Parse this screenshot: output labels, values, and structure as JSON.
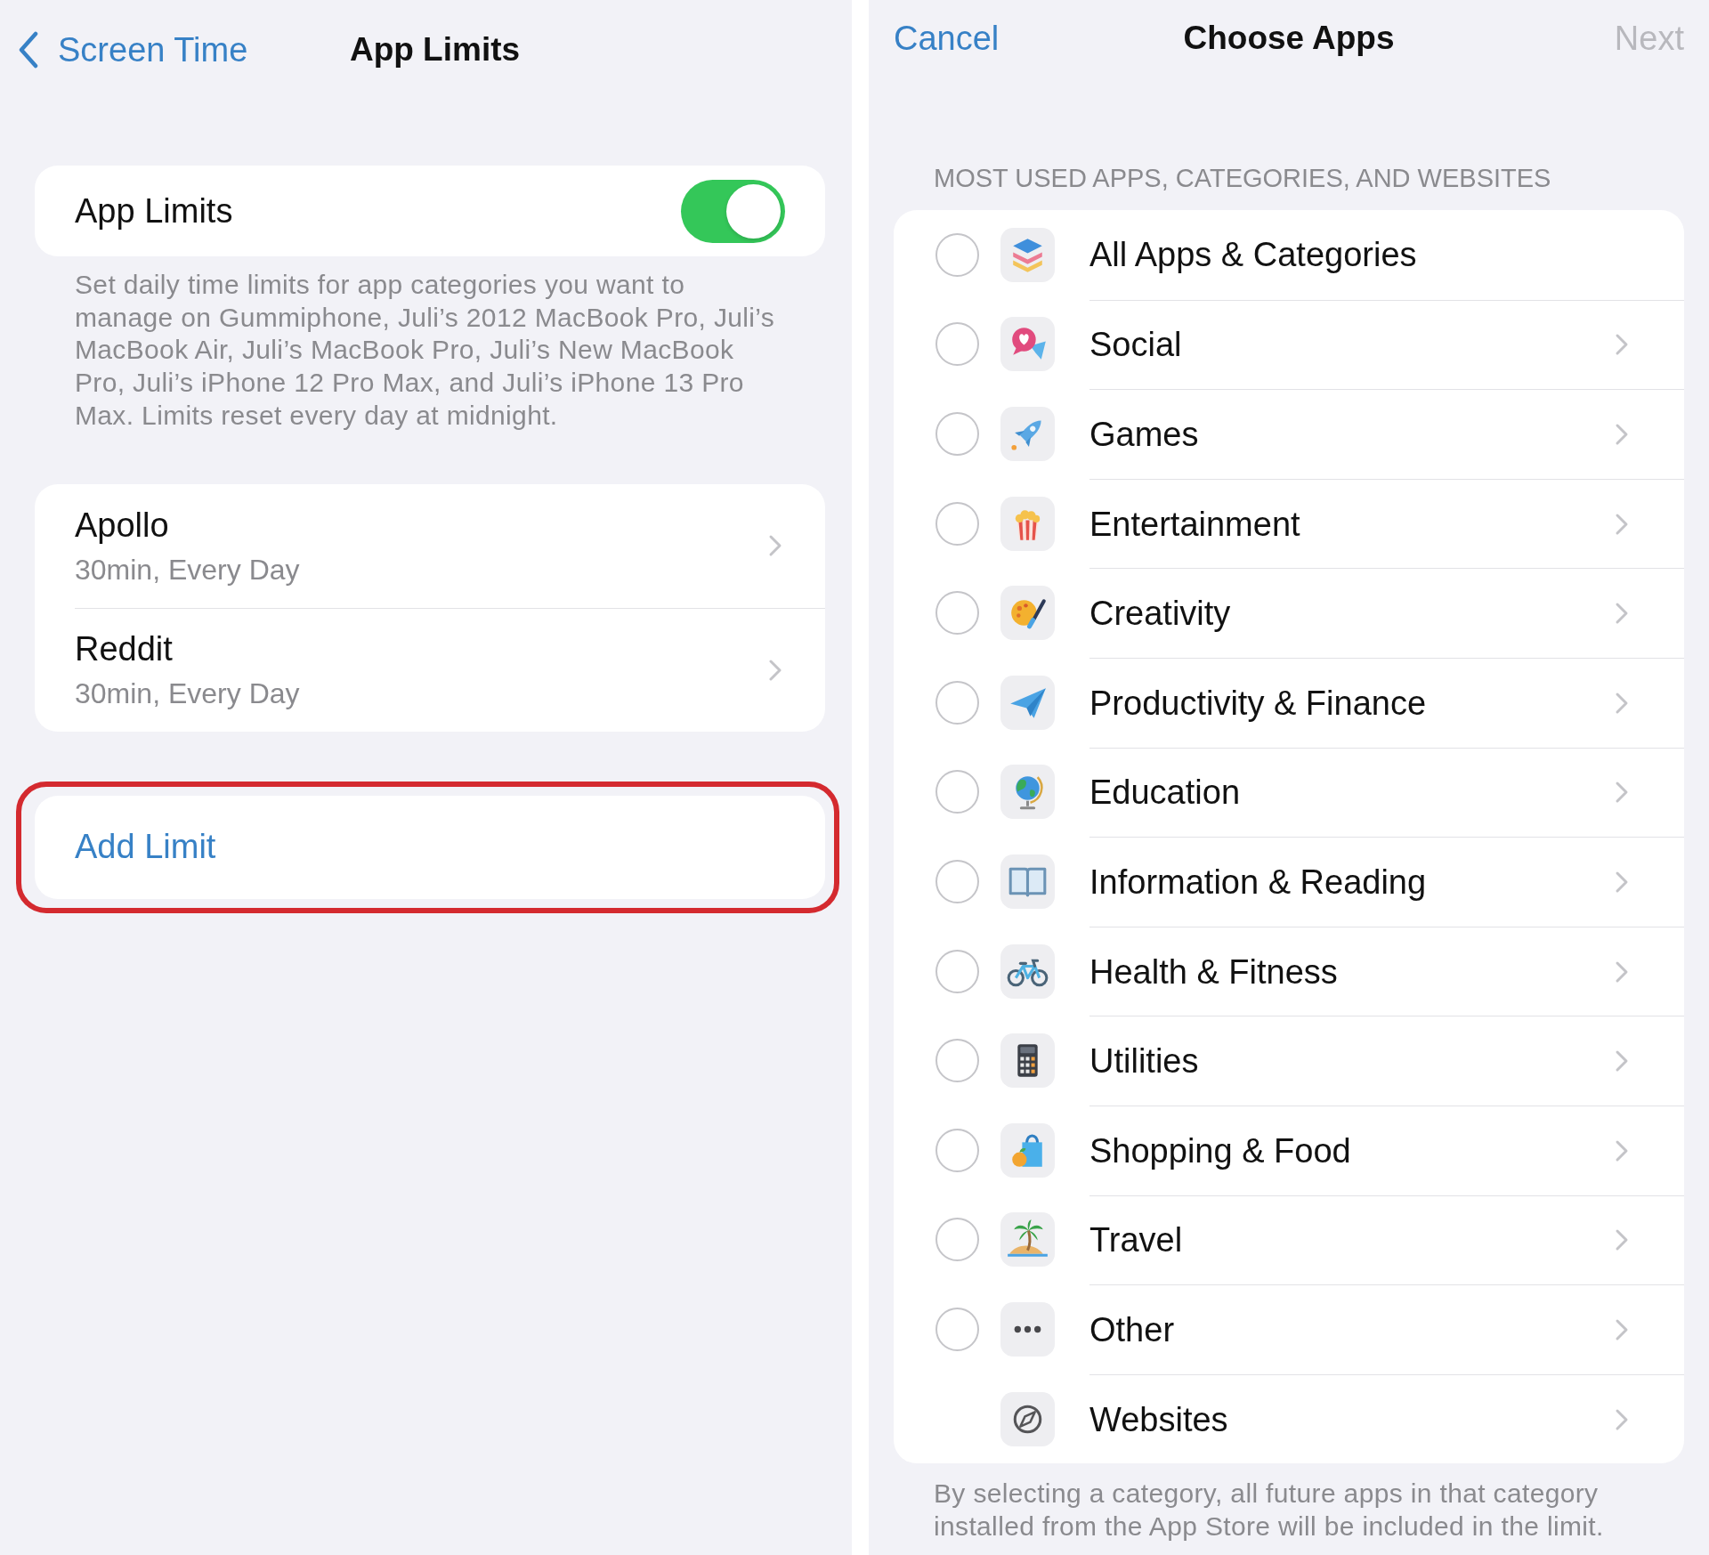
{
  "app_limits_screen": {
    "nav": {
      "back": "Screen Time",
      "title": "App Limits"
    },
    "toggle_row": {
      "label": "App Limits",
      "on": true
    },
    "footer": "Set daily time limits for app categories you want to manage on Gummiphone, Juli’s 2012 MacBook Pro, Juli’s MacBook Air, Juli’s MacBook Pro, Juli’s New MacBook Pro, Juli’s iPhone 12 Pro Max, and Juli’s iPhone 13 Pro Max. Limits reset every day at midnight.",
    "limits": [
      {
        "app": "Apollo",
        "schedule": "30min, Every Day"
      },
      {
        "app": "Reddit",
        "schedule": "30min, Every Day"
      }
    ],
    "add_limit": {
      "label": "Add Limit",
      "highlighted": true
    }
  },
  "choose_apps_screen": {
    "nav": {
      "cancel": "Cancel",
      "title": "Choose Apps",
      "next": {
        "label": "Next",
        "disabled": true
      }
    },
    "section_header": "MOST USED APPS, CATEGORIES, AND WEBSITES",
    "rows": [
      {
        "kind": "all",
        "label": "All Apps & Categories",
        "selected": false
      },
      {
        "kind": "category",
        "label": "Social",
        "selected": false
      },
      {
        "kind": "category",
        "label": "Games",
        "selected": false
      },
      {
        "kind": "category",
        "label": "Entertainment",
        "selected": false
      },
      {
        "kind": "category",
        "label": "Creativity",
        "selected": false
      },
      {
        "kind": "category",
        "label": "Productivity & Finance",
        "selected": false
      },
      {
        "kind": "category",
        "label": "Education",
        "selected": false
      },
      {
        "kind": "category",
        "label": "Information & Reading",
        "selected": false
      },
      {
        "kind": "category",
        "label": "Health & Fitness",
        "selected": false
      },
      {
        "kind": "category",
        "label": "Utilities",
        "selected": false
      },
      {
        "kind": "category",
        "label": "Shopping & Food",
        "selected": false
      },
      {
        "kind": "category",
        "label": "Travel",
        "selected": false
      },
      {
        "kind": "category",
        "label": "Other",
        "selected": false
      },
      {
        "kind": "websites",
        "label": "Websites"
      }
    ],
    "footer": "By selecting a category, all future apps in that category installed from the App Store will be included in the limit."
  }
}
